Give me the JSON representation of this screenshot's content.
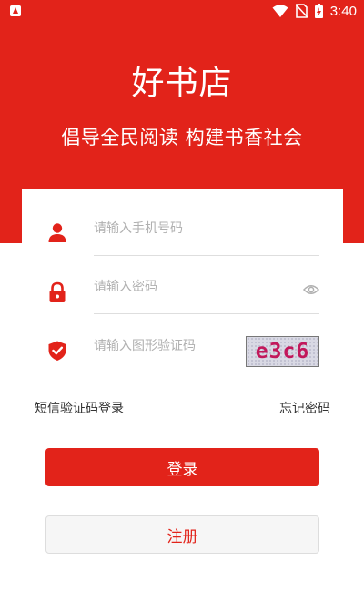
{
  "status_bar": {
    "time": "3:40",
    "icons": [
      "app-notification-icon",
      "wifi-icon",
      "no-sim-icon",
      "battery-charging-icon"
    ]
  },
  "header": {
    "title": "好书店",
    "slogan": "倡导全民阅读 构建书香社会"
  },
  "form": {
    "phone": {
      "placeholder": "请输入手机号码",
      "icon": "user-icon"
    },
    "password": {
      "placeholder": "请输入密码",
      "icon": "lock-icon",
      "toggle_icon": "eye-icon"
    },
    "captcha": {
      "placeholder": "请输入图形验证码",
      "icon": "shield-check-icon",
      "image_text": "e3c6"
    }
  },
  "links": {
    "sms_login": "短信验证码登录",
    "forgot_password": "忘记密码"
  },
  "buttons": {
    "login": "登录",
    "register": "注册"
  },
  "colors": {
    "brand_red": "#e2231a",
    "captcha_text": "#c2185b"
  }
}
